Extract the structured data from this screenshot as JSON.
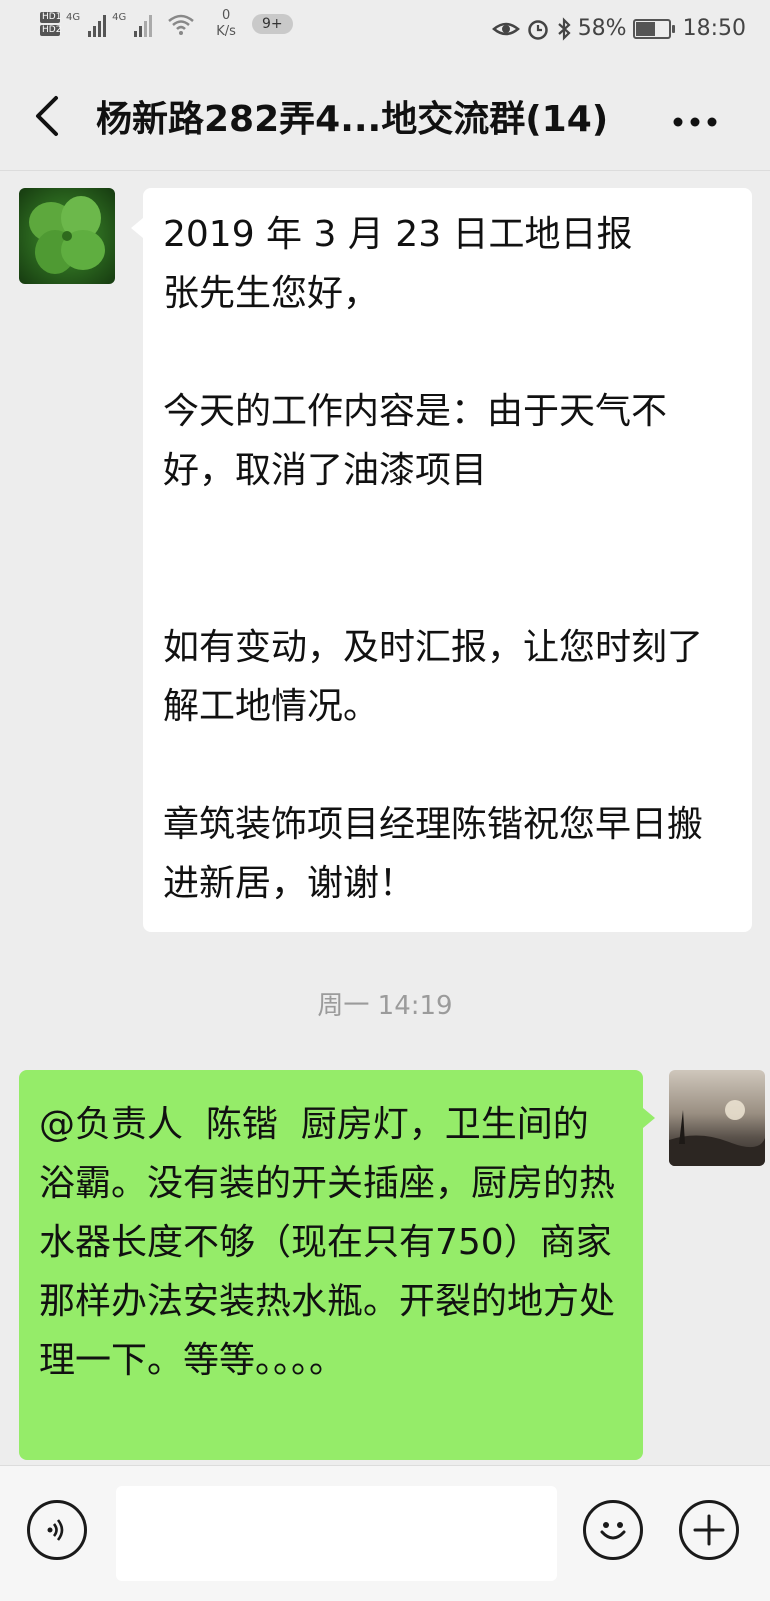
{
  "status_bar": {
    "hd1": "HD1",
    "hd2": "HD2",
    "signal1_label": "4G",
    "signal2_label": "4G",
    "net_speed_value": "0",
    "net_speed_unit": "K/s",
    "notification_badge": "9+",
    "battery_percent": "58%",
    "battery_level": 0.58,
    "time": "18:50",
    "icons": [
      "eye-icon",
      "alarm-icon",
      "bluetooth-icon"
    ]
  },
  "header": {
    "title": "杨新路282弄4...地交流群(14)",
    "back_icon": "back-chevron-icon",
    "more_icon": "more-dots-icon"
  },
  "messages": [
    {
      "side": "left",
      "text": "2019 年 3 月 23 日工地日报\n张先生您好，\n\n今天的工作内容是：由于天气不好，取消了油漆项目\n\n\n如有变动，及时汇报，让您时刻了解工地情况。\n\n章筑装饰项目经理陈锴祝您早日搬进新居，谢谢！"
    },
    {
      "side": "right",
      "text": "@负责人  陈锴  厨房灯，卫生间的浴霸。没有装的开关插座，厨房的热水器长度不够（现在只有750）商家那样办法安装热水瓶。开裂的地方处理一下。等等。。。。"
    }
  ],
  "timestamp": "周一 14:19",
  "input_bar": {
    "voice_icon": "voice-icon",
    "emoji_icon": "emoji-icon",
    "plus_icon": "plus-icon",
    "text_value": ""
  },
  "colors": {
    "background": "#ededed",
    "bubble_self": "#95ec69",
    "bubble_other": "#ffffff",
    "timestamp": "#9b9b9b"
  }
}
